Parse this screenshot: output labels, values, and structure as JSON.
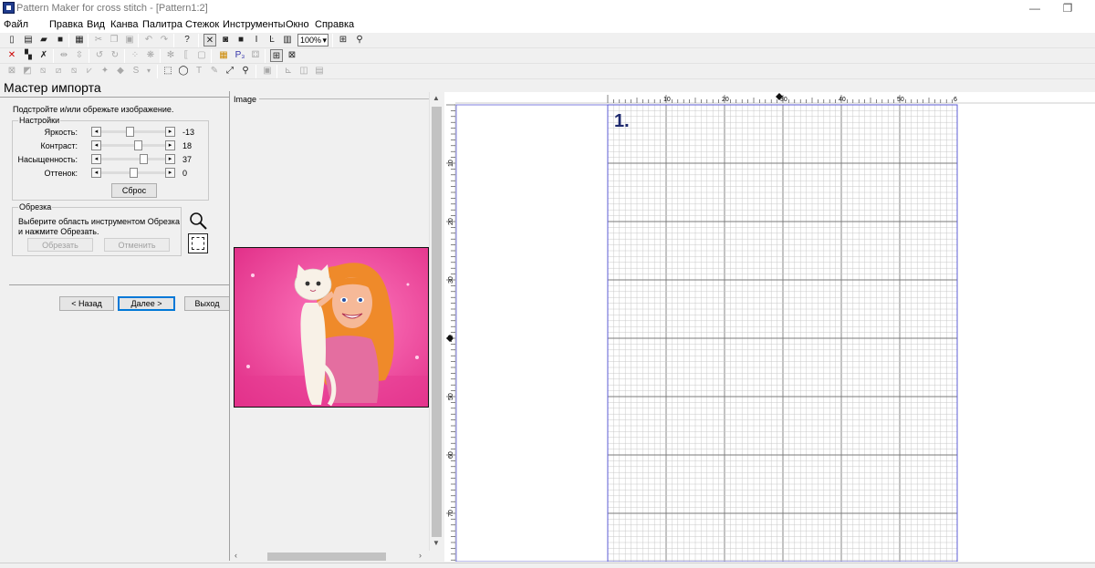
{
  "window": {
    "title": "Pattern Maker for cross stitch - [Pattern1:2]",
    "minimize_glyph": "—",
    "restore_glyph": "❐"
  },
  "menu": [
    "Файл",
    "Правка",
    "Вид",
    "Канва",
    "Палитра",
    "Стежок",
    "Инструменты",
    "Окно",
    "Справка"
  ],
  "toolbar": {
    "zoom": "100%",
    "text_tool_glyph": "T",
    "italic_glyph": "I"
  },
  "wizard": {
    "title": "Мастер импорта",
    "instruction": "Подстройте и/или обрежьте изображение.",
    "settings": {
      "legend": "Настройки",
      "sliders": [
        {
          "label": "Яркость:",
          "value": -13,
          "display": "-13"
        },
        {
          "label": "Контраст:",
          "value": 18,
          "display": "18"
        },
        {
          "label": "Насыщенность:",
          "value": 37,
          "display": "37"
        },
        {
          "label": "Оттенок:",
          "value": 0,
          "display": "0"
        }
      ],
      "reset": "Сброс"
    },
    "crop": {
      "legend": "Обрезка",
      "hint": "Выберите область инструментом Обрезка и нажмите Обрезать.",
      "crop_button": "Обрезать",
      "cancel_button": "Отменить"
    },
    "nav": {
      "back": "< Назад",
      "next": "Далее >",
      "exit": "Выход"
    }
  },
  "image_panel": {
    "label": "Image"
  },
  "pattern": {
    "page_label": "1.",
    "ruler_x": [
      "10",
      "20",
      "30",
      "40",
      "50",
      "6"
    ],
    "ruler_y": [
      "10",
      "20",
      "30",
      "40",
      "50",
      "60",
      "70"
    ]
  },
  "colors": {
    "grid_minor": "#c8c8c8",
    "grid_major": "#7a7a7a",
    "page_border": "#5c5cd6",
    "label": "#1f2a6e",
    "preview_bg": "#f04a9a"
  }
}
